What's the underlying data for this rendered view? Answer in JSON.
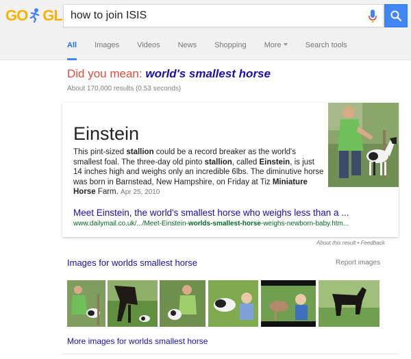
{
  "header": {
    "logo": {
      "g": "GO",
      "gle": "GLE"
    },
    "search": {
      "value": "how to join ISIS"
    },
    "colors": {
      "accent": "#4285f4",
      "logo": "#f4b400"
    }
  },
  "tabs": [
    {
      "label": "All",
      "active": true
    },
    {
      "label": "Images"
    },
    {
      "label": "Videos"
    },
    {
      "label": "News"
    },
    {
      "label": "Shopping"
    },
    {
      "label": "More"
    },
    {
      "label": "Search tools"
    }
  ],
  "didyoumean": {
    "prefix": "Did you mean:",
    "suggestion": "world's smallest horse"
  },
  "stats": "About 170,000 results (0.53 seconds)",
  "card": {
    "title": "Einstein",
    "text_parts": [
      {
        "t": "This pint-sized "
      },
      {
        "b": "stallion"
      },
      {
        "t": " could be a record breaker as the world's smallest foal. The three-day old pinto "
      },
      {
        "b": "stallion"
      },
      {
        "t": ", called "
      },
      {
        "b": "Einstein"
      },
      {
        "t": ", is just 14 inches high and weighs only an incredible 6lbs. The diminutive horse was born in Barnstead, New Hampshire, on Friday at Tiz "
      },
      {
        "b": "Miniature Horse"
      },
      {
        "t": " Farm."
      }
    ],
    "date": "Apr 25, 2010",
    "link": "Meet Einstein, the world's smallest horse who weighs less than a ...",
    "url_parts": [
      {
        "t": "www.dailymail.co.uk/.../Meet-Einstein-"
      },
      {
        "b": "worlds-smallest-horse"
      },
      {
        "t": "-weighs-newborn-baby.htm..."
      }
    ]
  },
  "feedback": "About this result • Feedback",
  "images": {
    "title": "Images for worlds smallest horse",
    "report": "Report images",
    "more": "More images for worlds smallest horse"
  }
}
